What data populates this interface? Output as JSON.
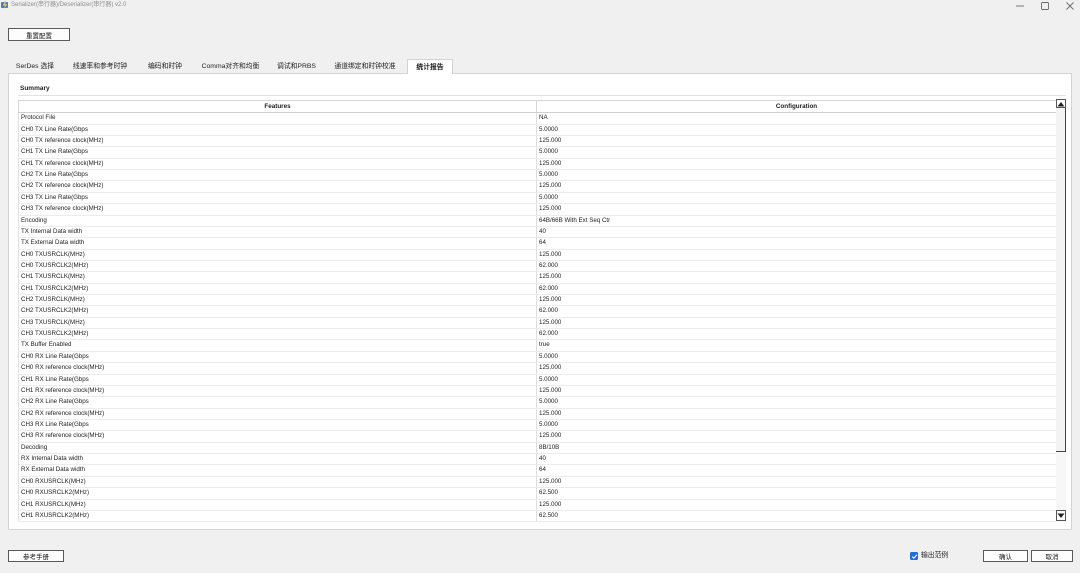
{
  "window": {
    "title": "Serializer(串行器)/Deserializer(串行器) v2.0",
    "icons": {
      "app": "app-icon",
      "minimize": "minimize-icon",
      "maximize": "maximize-icon",
      "close": "close-icon"
    }
  },
  "toolbar": {
    "reset_label": "重置配置"
  },
  "tabs": [
    {
      "label": "SerDes 选择",
      "active": false
    },
    {
      "label": "线速率和参考时钟",
      "active": false
    },
    {
      "label": "编码和时钟",
      "active": false
    },
    {
      "label": "Comma对齐和均衡",
      "active": false
    },
    {
      "label": "调试和PRBS",
      "active": false
    },
    {
      "label": "通道绑定和时钟校准",
      "active": false
    },
    {
      "label": "统计报告",
      "active": true
    }
  ],
  "summary": {
    "title": "Summary",
    "columns": {
      "features": "Features",
      "configuration": "Configuration"
    },
    "rows": [
      {
        "feature": "Protocol File",
        "value": "NA"
      },
      {
        "feature": "CH0 TX Line Rate(Gbps",
        "value": "5.0000"
      },
      {
        "feature": "CH0 TX reference clock(MHz)",
        "value": "125.000"
      },
      {
        "feature": "CH1 TX Line Rate(Gbps",
        "value": "5.0000"
      },
      {
        "feature": "CH1 TX reference clock(MHz)",
        "value": "125.000"
      },
      {
        "feature": "CH2 TX Line Rate(Gbps",
        "value": "5.0000"
      },
      {
        "feature": "CH2 TX reference clock(MHz)",
        "value": "125.000"
      },
      {
        "feature": "CH3 TX Line Rate(Gbps",
        "value": "5.0000"
      },
      {
        "feature": "CH3 TX reference clock(MHz)",
        "value": "125.000"
      },
      {
        "feature": "Encoding",
        "value": "64B/66B With Ext Seq Ctr"
      },
      {
        "feature": "TX Internal Data width",
        "value": "40"
      },
      {
        "feature": "TX External Data width",
        "value": "64"
      },
      {
        "feature": "CH0 TXUSRCLK(MHz)",
        "value": "125.000"
      },
      {
        "feature": "CH0 TXUSRCLK2(MHz)",
        "value": "62.000"
      },
      {
        "feature": "CH1 TXUSRCLK(MHz)",
        "value": "125.000"
      },
      {
        "feature": "CH1 TXUSRCLK2(MHz)",
        "value": "62.000"
      },
      {
        "feature": "CH2 TXUSRCLK(MHz)",
        "value": "125.000"
      },
      {
        "feature": "CH2 TXUSRCLK2(MHz)",
        "value": "62.000"
      },
      {
        "feature": "CH3 TXUSRCLK(MHz)",
        "value": "125.000"
      },
      {
        "feature": "CH3 TXUSRCLK2(MHz)",
        "value": "62.000"
      },
      {
        "feature": "TX Buffer Enabled",
        "value": "true"
      },
      {
        "feature": "CH0 RX Line Rate(Gbps",
        "value": "5.0000"
      },
      {
        "feature": "CH0 RX reference clock(MHz)",
        "value": "125.000"
      },
      {
        "feature": "CH1 RX Line Rate(Gbps",
        "value": "5.0000"
      },
      {
        "feature": "CH1 RX reference clock(MHz)",
        "value": "125.000"
      },
      {
        "feature": "CH2 RX Line Rate(Gbps",
        "value": "5.0000"
      },
      {
        "feature": "CH2 RX reference clock(MHz)",
        "value": "125.000"
      },
      {
        "feature": "CH3 RX Line Rate(Gbps",
        "value": "5.0000"
      },
      {
        "feature": "CH3 RX reference clock(MHz)",
        "value": "125.000"
      },
      {
        "feature": "Decoding",
        "value": "8B/10B"
      },
      {
        "feature": "RX Internal Data width",
        "value": "40"
      },
      {
        "feature": "RX External Data width",
        "value": "64"
      },
      {
        "feature": "CH0 RXUSRCLK(MHz)",
        "value": "125.000"
      },
      {
        "feature": "CH0 RXUSRCLK2(MHz)",
        "value": "62.500"
      },
      {
        "feature": "CH1 RXUSRCLK(MHz)",
        "value": "125.000"
      },
      {
        "feature": "CH1 RXUSRCLK2(MHz)",
        "value": "62.500"
      }
    ]
  },
  "footer": {
    "manual_label": "参考手册",
    "output_example": {
      "label": "输出范例",
      "checked": true
    },
    "confirm_label": "确认",
    "cancel_label": "取消"
  },
  "colors": {
    "window_background": "#f0f0f0",
    "panel_background": "#ffffff",
    "checkbox_accent": "#1d6fdc"
  }
}
